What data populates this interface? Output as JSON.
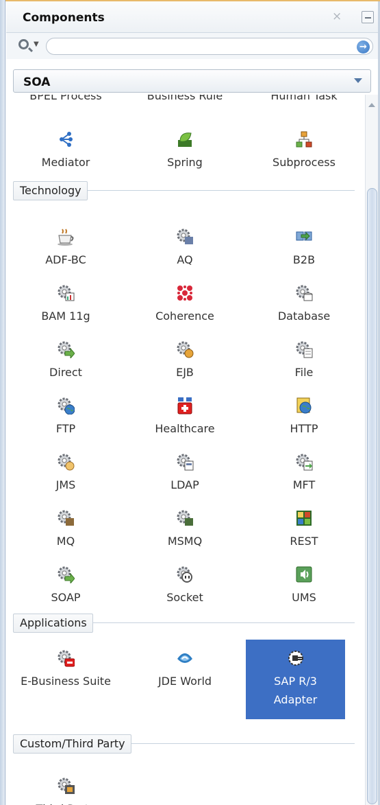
{
  "panel": {
    "title": "Components",
    "close_glyph": "×"
  },
  "search": {
    "value": "",
    "placeholder": "",
    "go_glyph": "→"
  },
  "palette_select": {
    "value": "SOA"
  },
  "cut_row_labels": [
    "BPEL Process",
    "Business Rule",
    "Human Task"
  ],
  "top_items": [
    {
      "label": "Mediator",
      "icon": "mediator-icon",
      "color": "#2f6fc4"
    },
    {
      "label": "Spring",
      "icon": "spring-icon",
      "color": "#5aa83c"
    },
    {
      "label": "Subprocess",
      "icon": "subprocess-icon",
      "color": "#d98a1e"
    }
  ],
  "sections": {
    "technology": {
      "label": "Technology",
      "items": [
        {
          "label": "ADF-BC",
          "icon": "coffee-cup-icon"
        },
        {
          "label": "AQ",
          "icon": "aq-adapter-icon"
        },
        {
          "label": "B2B",
          "icon": "b2b-icon"
        },
        {
          "label": "BAM 11g",
          "icon": "bam-adapter-icon"
        },
        {
          "label": "Coherence",
          "icon": "coherence-icon"
        },
        {
          "label": "Database",
          "icon": "database-adapter-icon"
        },
        {
          "label": "Direct",
          "icon": "direct-adapter-icon"
        },
        {
          "label": "EJB",
          "icon": "ejb-adapter-icon"
        },
        {
          "label": "File",
          "icon": "file-adapter-icon"
        },
        {
          "label": "FTP",
          "icon": "ftp-adapter-icon"
        },
        {
          "label": "Healthcare",
          "icon": "healthcare-icon"
        },
        {
          "label": "HTTP",
          "icon": "http-icon"
        },
        {
          "label": "JMS",
          "icon": "jms-adapter-icon"
        },
        {
          "label": "LDAP",
          "icon": "ldap-adapter-icon"
        },
        {
          "label": "MFT",
          "icon": "mft-adapter-icon"
        },
        {
          "label": "MQ",
          "icon": "mq-adapter-icon"
        },
        {
          "label": "MSMQ",
          "icon": "msmq-adapter-icon"
        },
        {
          "label": "REST",
          "icon": "rest-icon"
        },
        {
          "label": "SOAP",
          "icon": "soap-adapter-icon"
        },
        {
          "label": "Socket",
          "icon": "socket-adapter-icon"
        },
        {
          "label": "UMS",
          "icon": "ums-icon"
        }
      ]
    },
    "applications": {
      "label": "Applications",
      "items": [
        {
          "label": "E-Business Suite",
          "icon": "ebusiness-suite-icon"
        },
        {
          "label": "JDE World",
          "icon": "jde-world-icon"
        },
        {
          "label": "SAP R/3 Adapter",
          "icon": "sap-adapter-icon"
        }
      ]
    },
    "custom": {
      "label": "Custom/Third Party",
      "items": [
        {
          "label": "Third Party",
          "icon": "third-party-adapter-icon"
        }
      ]
    }
  },
  "colors": {
    "selection": "#3d6fc4",
    "accent": "#e8b96a"
  }
}
